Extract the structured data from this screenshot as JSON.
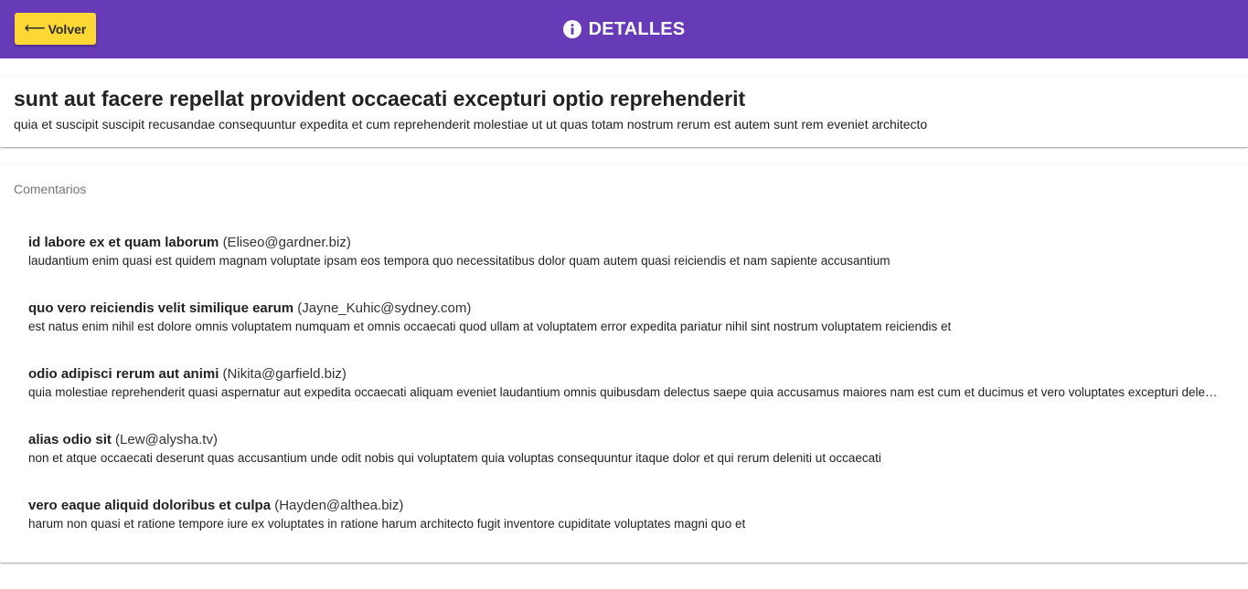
{
  "header": {
    "back_label": "Volver",
    "back_icon": "left-arrow-icon",
    "title": "DETALLES",
    "title_icon": "info-icon",
    "bg_color": "#673ab7",
    "back_bg_color": "#fdd835"
  },
  "post": {
    "title": "sunt aut facere repellat provident occaecati excepturi optio reprehenderit",
    "body": "quia et suscipit suscipit recusandae consequuntur expedita et cum reprehenderit molestiae ut ut quas totam nostrum rerum est autem sunt rem eveniet architecto"
  },
  "comments": {
    "label": "Comentarios",
    "items": [
      {
        "name": "id labore ex et quam laborum",
        "email": "(Eliseo@gardner.biz)",
        "body": "laudantium enim quasi est quidem magnam voluptate ipsam eos tempora quo necessitatibus dolor quam autem quasi reiciendis et nam sapiente accusantium"
      },
      {
        "name": "quo vero reiciendis velit similique earum",
        "email": "(Jayne_Kuhic@sydney.com)",
        "body": "est natus enim nihil est dolore omnis voluptatem numquam et omnis occaecati quod ullam at voluptatem error expedita pariatur nihil sint nostrum voluptatem reiciendis et"
      },
      {
        "name": "odio adipisci rerum aut animi",
        "email": "(Nikita@garfield.biz)",
        "body": "quia molestiae reprehenderit quasi aspernatur aut expedita occaecati aliquam eveniet laudantium omnis quibusdam delectus saepe quia accusamus maiores nam est cum et ducimus et vero voluptates excepturi deleniti ratione"
      },
      {
        "name": "alias odio sit",
        "email": "(Lew@alysha.tv)",
        "body": "non et atque occaecati deserunt quas accusantium unde odit nobis qui voluptatem quia voluptas consequuntur itaque dolor et qui rerum deleniti ut occaecati"
      },
      {
        "name": "vero eaque aliquid doloribus et culpa",
        "email": "(Hayden@althea.biz)",
        "body": "harum non quasi et ratione tempore iure ex voluptates in ratione harum architecto fugit inventore cupiditate voluptates magni quo et"
      }
    ]
  }
}
